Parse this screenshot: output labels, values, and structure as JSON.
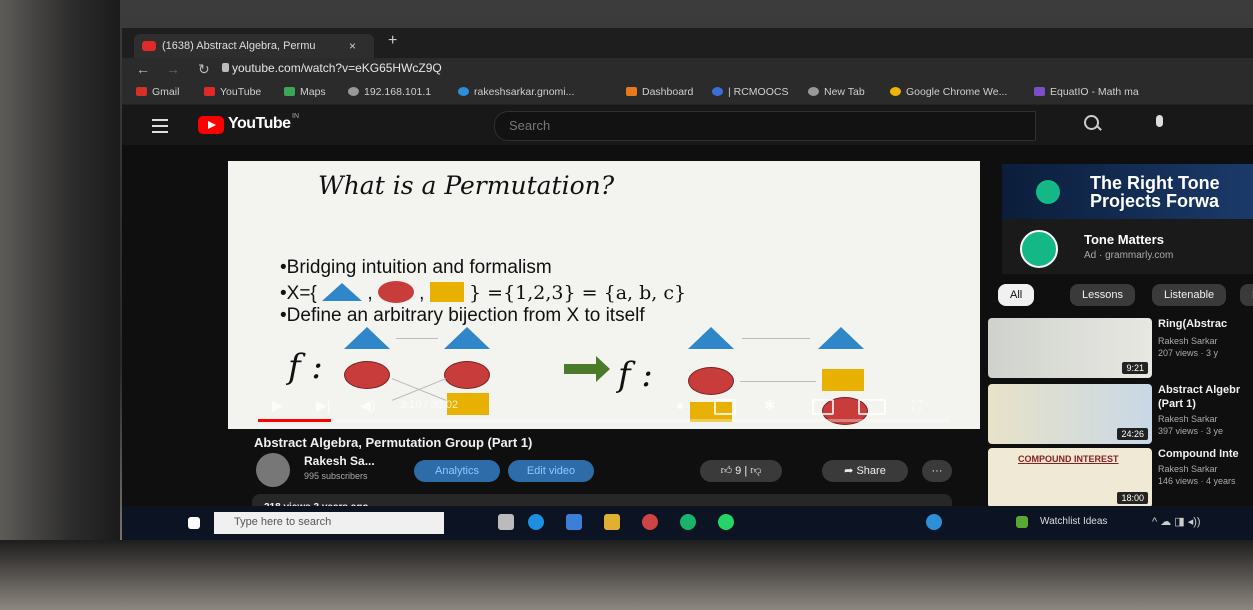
{
  "browser": {
    "tab_title": "(1638) Abstract Algebra, Permu",
    "tab_close": "×",
    "new_tab": "+",
    "url": "youtube.com/watch?v=eKG65HWcZ9Q",
    "bookmarks": [
      "Gmail",
      "YouTube",
      "Maps",
      "192.168.101.1",
      "rakeshsarkar.gnomi...",
      "Dashboard",
      "| RCMOOCS",
      "New Tab",
      "Google Chrome We...",
      "EquatIO - Math ma"
    ]
  },
  "youtube": {
    "logo": "YouTube",
    "country": "IN",
    "search_placeholder": "Search"
  },
  "slide": {
    "title": "What is a Permutation?",
    "bullet1": "•Bridging intuition and formalism",
    "bullet2_prefix": "•X={",
    "bullet2_suffix": "} ={1,2,3} = {a, b, c}",
    "bullet3": "•Define an arbitrary bijection from X to  itself",
    "f_label": "f :"
  },
  "player": {
    "time": "3:10 / 30:02",
    "progress": 0.105
  },
  "video": {
    "title": "Abstract Algebra, Permutation Group (Part 1)",
    "channel": "Rakesh Sa...",
    "subscribers": "995 subscribers",
    "analytics": "Analytics",
    "edit": "Edit video",
    "likes": "9",
    "share": "Share",
    "more": "···",
    "views_date": "218 views  3 years ago"
  },
  "ad": {
    "headline": "The Right Tone\nProjects Forwa",
    "name": "Tone Matters",
    "sub": "Ad · grammarly.com"
  },
  "chips": [
    "All",
    "Lessons",
    "Listenable",
    "R"
  ],
  "related": [
    {
      "title": "Ring(Abstrac",
      "channel": "Rakesh Sarkar",
      "meta": "207 views · 3 y",
      "duration": "9:21"
    },
    {
      "title": "Abstract Algebr",
      "title2": "(Part 1)",
      "channel": "Rakesh Sarkar",
      "meta": "397 views · 3 ye",
      "duration": "24:26"
    },
    {
      "title": "Compound Inte",
      "channel": "Rakesh Sarkar",
      "meta": "146 views · 4 years",
      "duration": "18:00",
      "thumb_text": "COMPOUND INTEREST"
    }
  ],
  "taskbar": {
    "search": "Type here to search",
    "watchlist": "Watchlist Ideas"
  }
}
